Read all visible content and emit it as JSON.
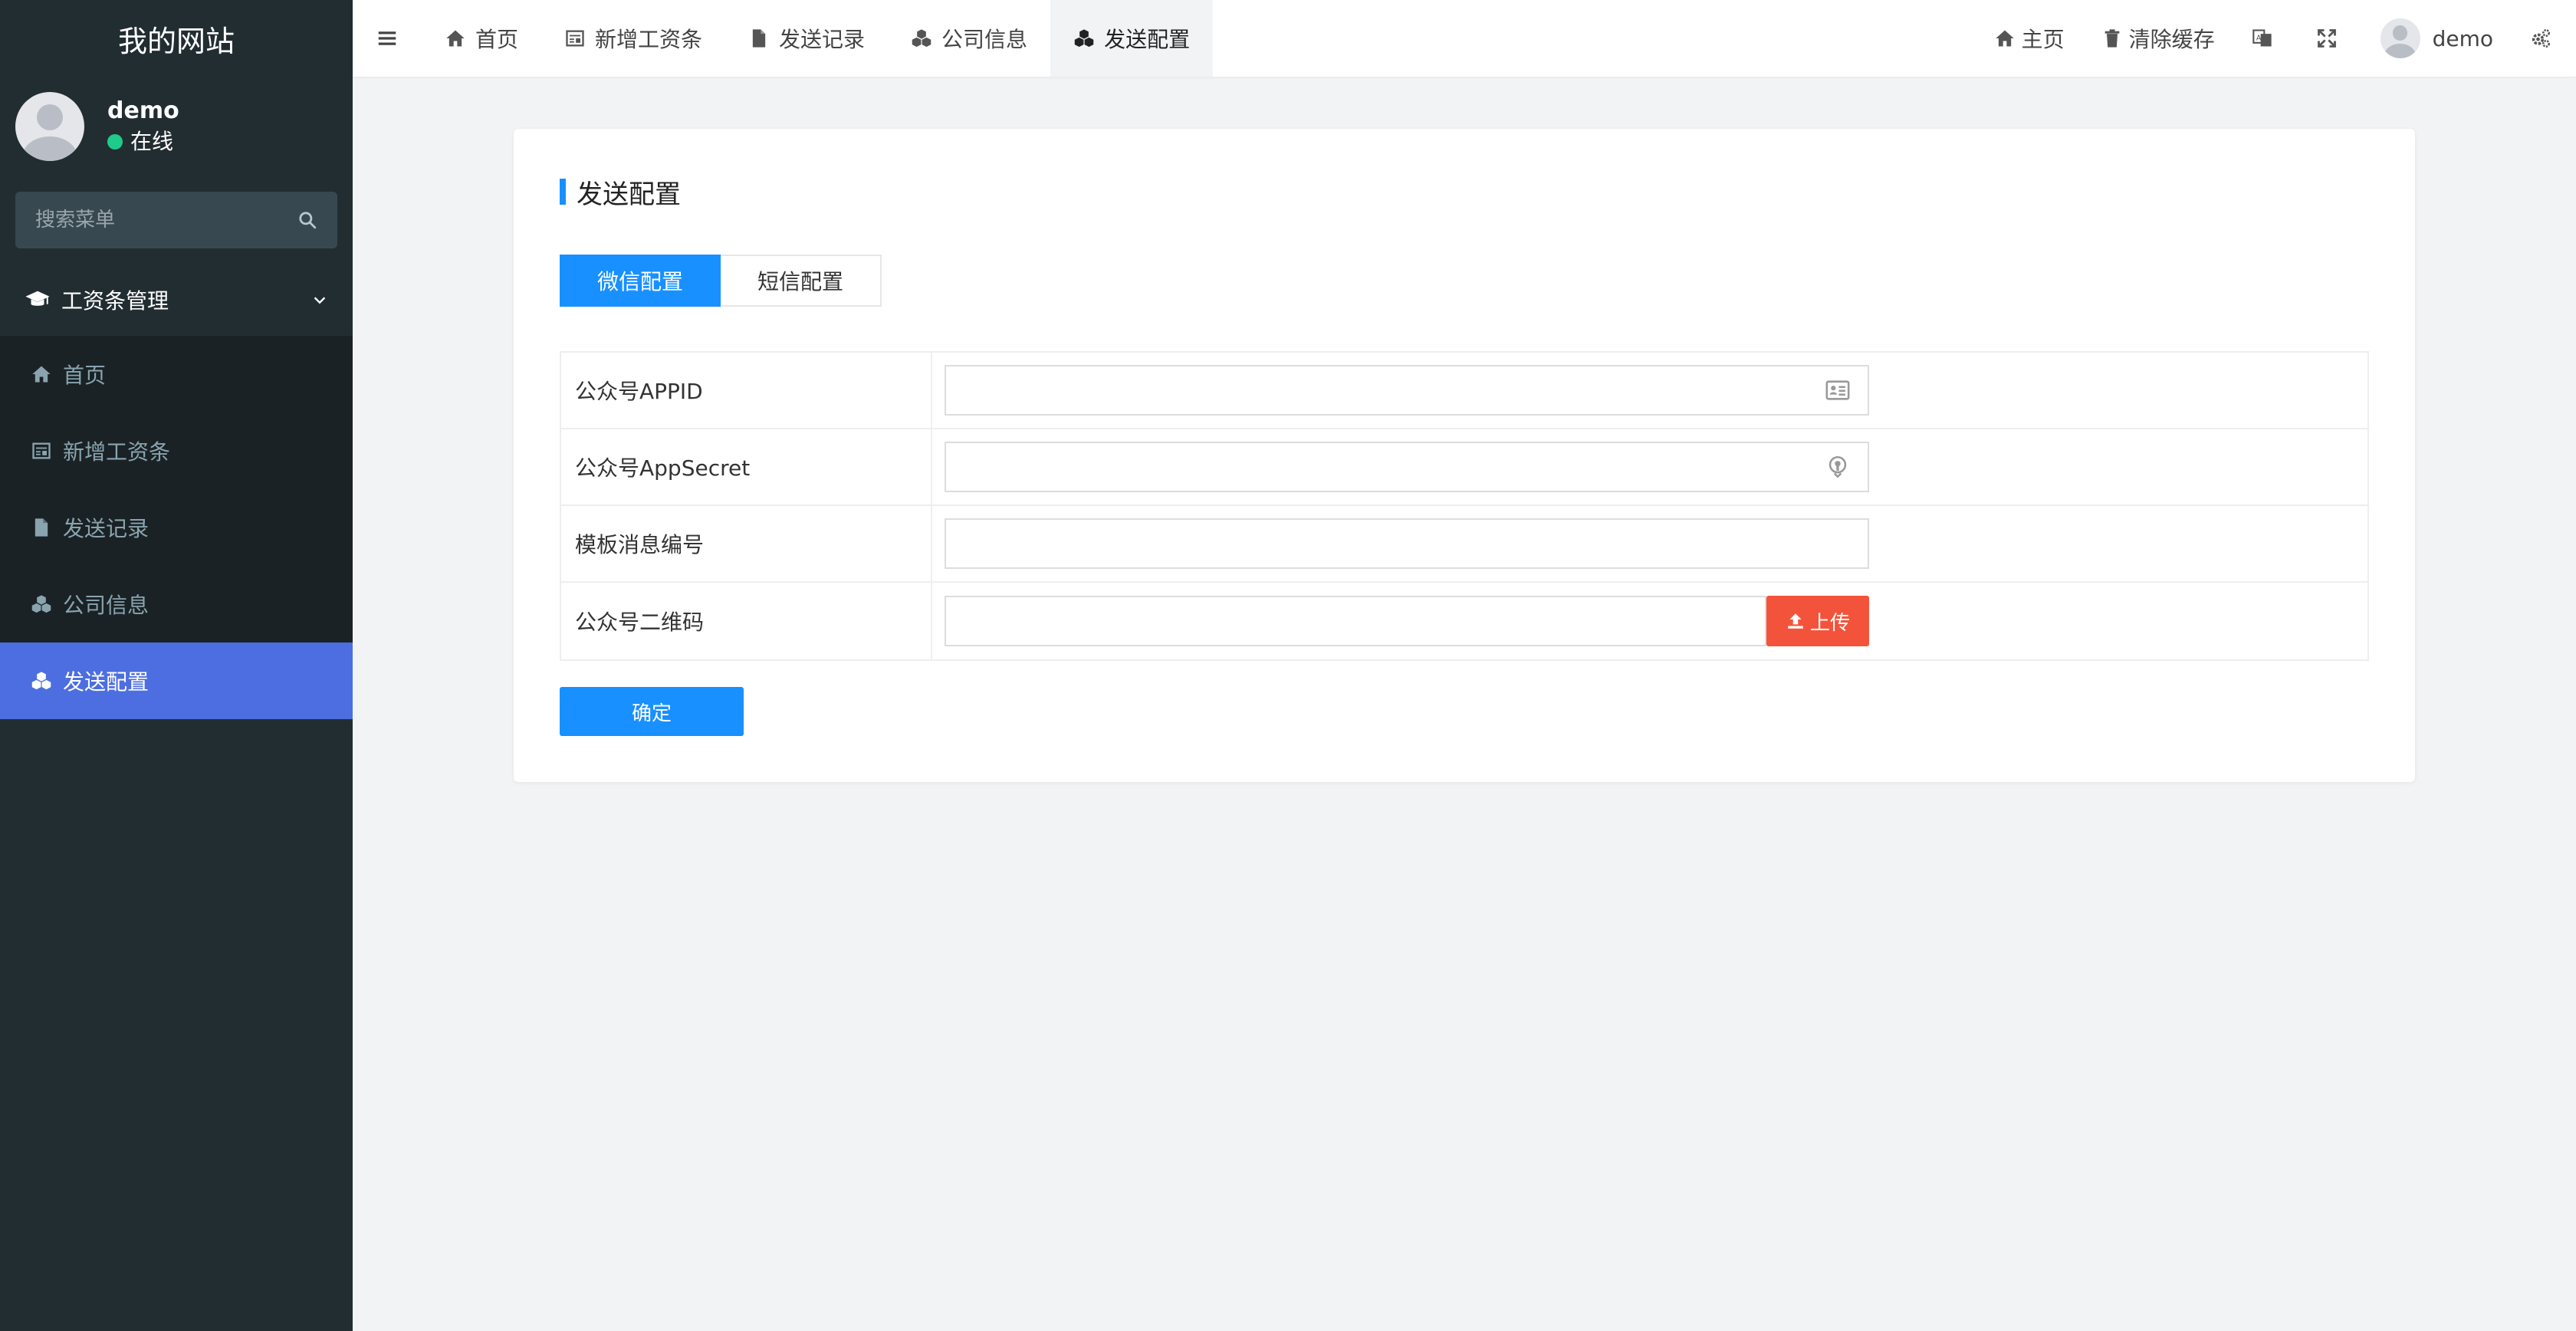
{
  "sidebar": {
    "brand": "我的网站",
    "user": {
      "name": "demo",
      "status": "在线"
    },
    "search_placeholder": "搜索菜单",
    "group": {
      "label": "工资条管理",
      "icon": "graduation-cap-icon"
    },
    "items": [
      {
        "label": "首页",
        "icon": "home-icon",
        "active": false
      },
      {
        "label": "新增工资条",
        "icon": "newspaper-icon",
        "active": false
      },
      {
        "label": "发送记录",
        "icon": "file-icon",
        "active": false
      },
      {
        "label": "公司信息",
        "icon": "cubes-icon",
        "active": false
      },
      {
        "label": "发送配置",
        "icon": "cubes-icon",
        "active": true
      }
    ]
  },
  "topbar": {
    "tabs": [
      {
        "label": "首页",
        "icon": "home-icon",
        "active": false
      },
      {
        "label": "新增工资条",
        "icon": "newspaper-icon",
        "active": false
      },
      {
        "label": "发送记录",
        "icon": "file-icon",
        "active": false
      },
      {
        "label": "公司信息",
        "icon": "cubes-icon",
        "active": false
      },
      {
        "label": "发送配置",
        "icon": "cubes-icon",
        "active": true
      }
    ],
    "right": {
      "home": "主页",
      "clear_cache": "清除缓存",
      "user": "demo"
    }
  },
  "card": {
    "title": "发送配置",
    "tabs": [
      {
        "label": "微信配置",
        "active": true
      },
      {
        "label": "短信配置",
        "active": false
      }
    ],
    "fields": [
      {
        "label": "公众号APPID",
        "value": "",
        "icon": "id-card-icon"
      },
      {
        "label": "公众号AppSecret",
        "value": "",
        "icon": "key-icon"
      },
      {
        "label": "模板消息编号",
        "value": ""
      },
      {
        "label": "公众号二维码",
        "value": "",
        "button": "上传"
      }
    ],
    "submit": "确定"
  },
  "colors": {
    "sidebar_bg": "#222d32",
    "sidebar_active": "#4c6ee0",
    "primary": "#1890ff",
    "danger": "#f4533b",
    "status_online": "#1fcb8a"
  }
}
